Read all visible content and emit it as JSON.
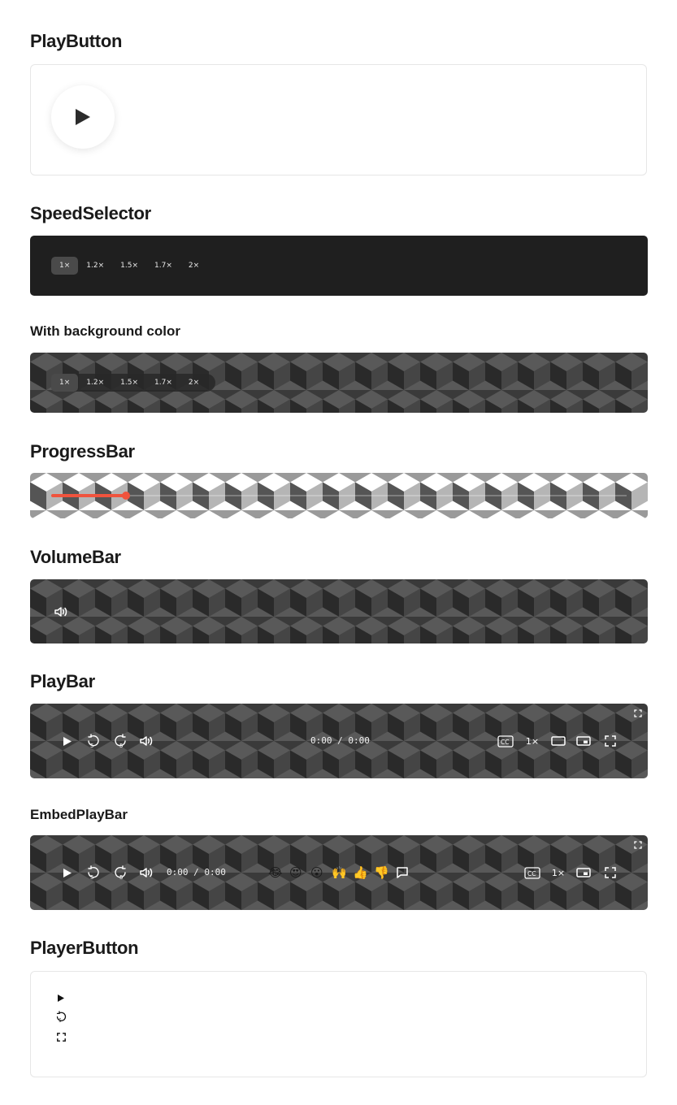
{
  "sections": {
    "play_button": "PlayButton",
    "speed_selector": "SpeedSelector",
    "with_bg": "With background color",
    "progress_bar": "ProgressBar",
    "volume_bar": "VolumeBar",
    "play_bar": "PlayBar",
    "embed_play_bar": "EmbedPlayBar",
    "player_button": "PlayerButton"
  },
  "speeds": [
    "1×",
    "1.2×",
    "1.5×",
    "1.7×",
    "2×"
  ],
  "selected_speed": "1×",
  "progress": {
    "fraction": 0.13,
    "color": "#f0533d"
  },
  "playbar": {
    "time": "0:00 / 0:00",
    "rate": "1×"
  },
  "embed": {
    "time": "0:00 / 0:00",
    "rate": "1×",
    "reactions": [
      "😂",
      "😍",
      "😮",
      "🙌",
      "👍",
      "👎"
    ]
  },
  "icons": {
    "play": "play-icon",
    "rewind": "rewind-5-icon",
    "forward": "forward-5-icon",
    "volume": "volume-icon",
    "captions": "captions-icon",
    "theater": "theater-mode-icon",
    "pip": "picture-in-picture-icon",
    "fullscreen": "fullscreen-icon",
    "comment": "comment-icon"
  },
  "colors": {
    "dark_bg": "#1f1f1f",
    "accent": "#f0533d"
  }
}
